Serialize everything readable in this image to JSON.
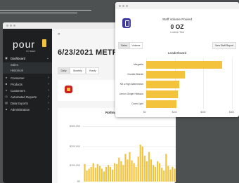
{
  "back_window": {
    "brand": {
      "logo_text": "pour",
      "logo_sub": "MY BEER"
    },
    "nav_items": [
      {
        "key": "dashboard",
        "label": "Dashboard",
        "icon": "dashboard-icon",
        "active": true,
        "expand": "⌄"
      },
      {
        "key": "sales",
        "label": "Sales",
        "sub": true
      },
      {
        "key": "historical",
        "label": "Historical",
        "sub": true
      },
      {
        "key": "consumer",
        "label": "Consumer",
        "icon": "user-icon",
        "expand": "›"
      },
      {
        "key": "products",
        "label": "Products",
        "icon": "box-icon",
        "expand": "›"
      },
      {
        "key": "customers",
        "label": "Customers",
        "icon": "people-icon",
        "expand": "›"
      },
      {
        "key": "automated_reports",
        "label": "Automated Reports",
        "icon": "clock-icon",
        "expand": "›"
      },
      {
        "key": "data_exports",
        "label": "Data Exports",
        "icon": "download-icon",
        "expand": "›"
      },
      {
        "key": "administration",
        "label": "Administration",
        "icon": "admin-icon",
        "expand": "›"
      }
    ],
    "back_label": "«",
    "date_title": "6/23/2021 METRICS",
    "period_tabs": [
      {
        "label": "Daily",
        "active": true
      },
      {
        "label": "Monthly",
        "active": false
      },
      {
        "label": "Yearly",
        "active": false
      }
    ],
    "chart_title_partial": "Rolling",
    "chart_data": {
      "type": "bar",
      "title": "Rolling",
      "ytick_labels": [
        "$300,000",
        "$200,000",
        "$100,000",
        "$0"
      ],
      "ylim": [
        0,
        300000
      ],
      "values": [
        95000,
        60000,
        70000,
        80000,
        100000,
        75000,
        95000,
        85000,
        70000,
        55000,
        80000,
        90000,
        80000,
        65000,
        100000,
        95000,
        130000,
        110000,
        90000,
        150000,
        120000,
        160000,
        115000,
        100000,
        80000,
        135000,
        200000,
        190000,
        140000,
        110000,
        160000,
        120000,
        90000,
        80000,
        110000,
        100000,
        75000,
        60000,
        150000,
        85000,
        65000,
        80000,
        70000
      ]
    }
  },
  "front_window": {
    "stat_title": "Staff Volume Poured",
    "stat_value": "0 OZ",
    "stat_sub": "Location Total",
    "tabs": [
      {
        "label": "Sales",
        "active": true
      },
      {
        "label": "Volume",
        "active": false
      }
    ],
    "new_report_label": "New Staff Report",
    "leaderboard_title": "Leaderboard",
    "chart_data": {
      "type": "bar",
      "orientation": "horizontal",
      "title": "Leaderboard",
      "categories": [
        "Margarita",
        "Drunkle Blonde",
        "Kill a High Watermelon",
        "Lemon Ginger Hibiscus",
        "Coors Light"
      ],
      "values": [
        265,
        135,
        115,
        110,
        105
      ],
      "xticks": [
        "$0",
        "$100",
        "$200",
        "$300"
      ],
      "xlim": [
        0,
        300
      ]
    }
  },
  "colors": {
    "accent": "#f3c33c",
    "sidebar": "#1d1f21",
    "purple_icon": "#3f3ba2",
    "red_icon": "#c9201f"
  }
}
